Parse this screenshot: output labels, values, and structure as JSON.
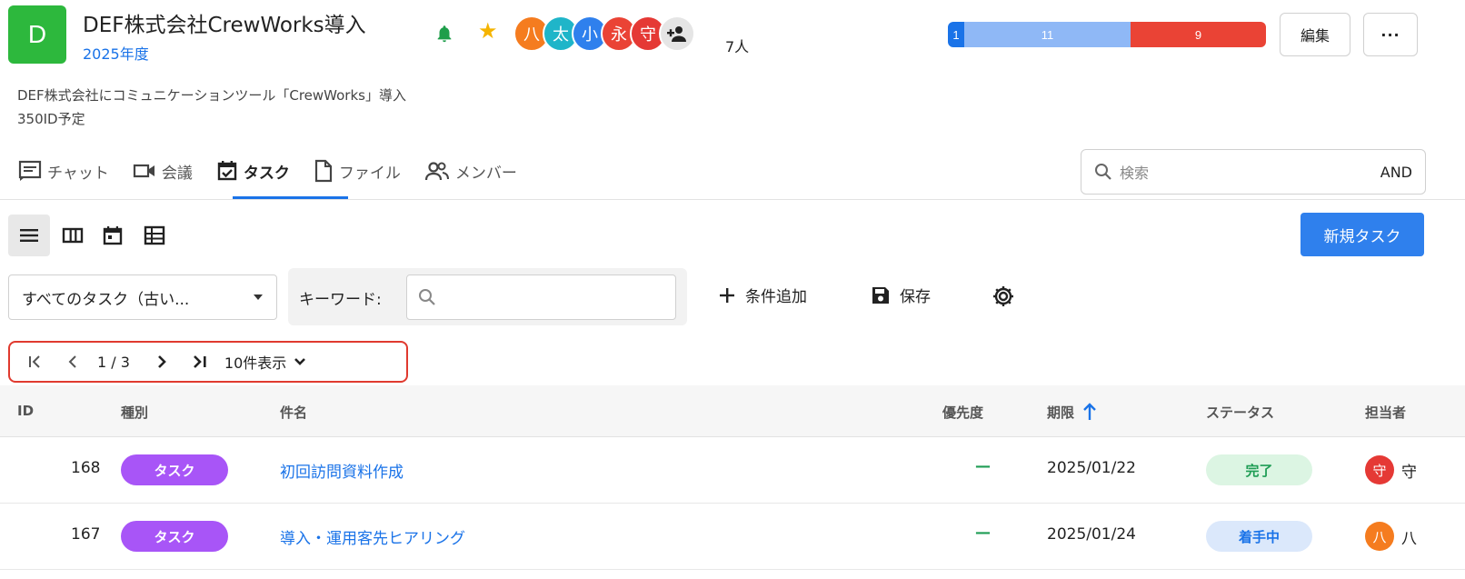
{
  "project": {
    "logo_letter": "D",
    "title": "DEF株式会社CrewWorks導入",
    "year": "2025年度",
    "description_line1": "DEF株式会社にコミュニケーションツール「CrewWorks」導入",
    "description_line2": "350ID予定",
    "member_count": "7人"
  },
  "members": [
    {
      "initial": "八",
      "color": "#f57c1f"
    },
    {
      "initial": "太",
      "color": "#1fb5c9"
    },
    {
      "initial": "小",
      "color": "#2f80ed"
    },
    {
      "initial": "永",
      "color": "#ea4335"
    },
    {
      "initial": "守",
      "color": "#e53935"
    }
  ],
  "status_counts": {
    "first": "1",
    "second": "11",
    "third": "9"
  },
  "header_buttons": {
    "edit": "編集",
    "more": "···"
  },
  "tabs": [
    {
      "label": "チャット"
    },
    {
      "label": "会議"
    },
    {
      "label": "タスク"
    },
    {
      "label": "ファイル"
    },
    {
      "label": "メンバー"
    }
  ],
  "search": {
    "placeholder": "検索",
    "mode": "AND"
  },
  "new_task_label": "新規タスク",
  "filter": {
    "selected": "すべてのタスク（古い...",
    "keyword_label": "キーワード:",
    "add_condition": "条件追加",
    "save": "保存"
  },
  "pagination": {
    "page_text": "1 / 3",
    "page_size": "10件表示"
  },
  "table": {
    "headers": {
      "id": "ID",
      "type": "種別",
      "subject": "件名",
      "priority": "優先度",
      "due": "期限",
      "status": "ステータス",
      "assignee": "担当者"
    },
    "rows": [
      {
        "id": "168",
        "type": "タスク",
        "subject": "初回訪問資料作成",
        "priority": "—",
        "due": "2025/01/22",
        "status": "完了",
        "status_bg": "#dcf5e3",
        "status_fg": "#1f9d55",
        "assignee_initial": "守",
        "assignee_name": "守",
        "assignee_color": "#e53935"
      },
      {
        "id": "167",
        "type": "タスク",
        "subject": "導入・運用客先ヒアリング",
        "priority": "—",
        "due": "2025/01/24",
        "status": "着手中",
        "status_bg": "#dbe8fb",
        "status_fg": "#1a73e8",
        "assignee_initial": "八",
        "assignee_name": "八",
        "assignee_color": "#f57c1f"
      }
    ]
  }
}
